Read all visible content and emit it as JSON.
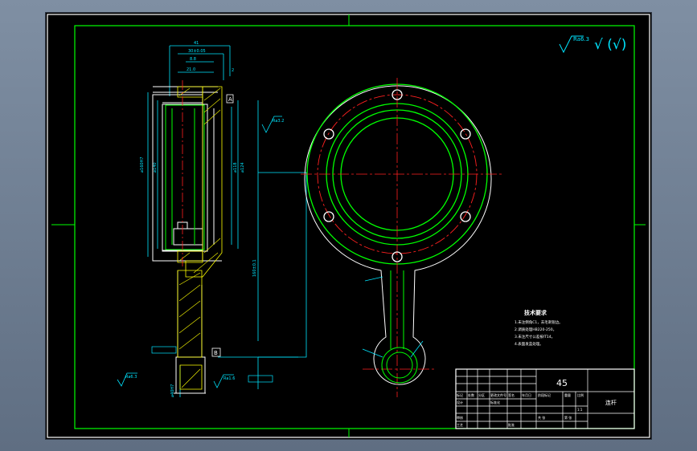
{
  "surface_note": "√ (√)",
  "surface_roughness_global": "Ra6.3",
  "section_labels": {
    "datum_a": "A",
    "datum_b": "B"
  },
  "roughness_left": [
    "Ra3.2",
    "Ra1.6",
    "Ra6.3"
  ],
  "tech_requirements": {
    "title": "技术要求",
    "items": [
      "1.未注倒角C1，去毛刺锐边。",
      "2.调质处理HB220-250。",
      "3.未注尺寸公差按IT14。",
      "4.表面发蓝处理。"
    ]
  },
  "title_block": {
    "material": "45",
    "part_name": "连杆",
    "labels": [
      "标记",
      "处数",
      "分区",
      "更改文件号",
      "签名",
      "年月日",
      "设计",
      "审核",
      "工艺",
      "批准",
      "标准化",
      "阶段标记",
      "重量",
      "比例",
      "共 张",
      "第 张"
    ],
    "scale": "1:1"
  },
  "colors": {
    "frame": "#00ff00",
    "outline": "#ffffff",
    "dimension": "#00e5ff",
    "centerline": "#ff2020",
    "hatch": "#ffff00",
    "title_text": "#ffffff"
  }
}
